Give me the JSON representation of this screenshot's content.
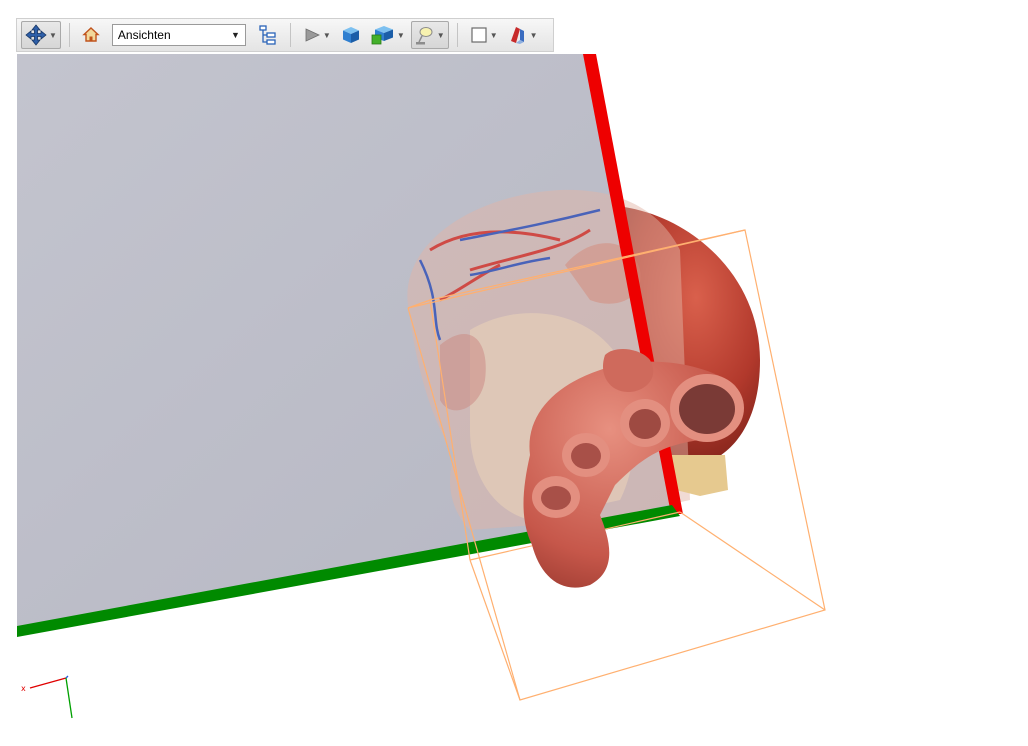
{
  "toolbar": {
    "views_select": {
      "value": "Ansichten"
    },
    "icons": [
      "move-icon",
      "home-icon",
      "model-tree-icon",
      "play-icon",
      "solid-box-icon",
      "render-mode-icon",
      "lighting-icon",
      "background-color-icon",
      "cross-section-icon"
    ]
  },
  "viewport": {
    "plane_color": "#bcbdc8",
    "red_axis_color": "#ee0000",
    "green_axis_color": "#008a00",
    "bounding_box_color": "#ffb070",
    "heart_color": "#c85a4c",
    "vessel_color": "#d4796b"
  },
  "axis_triad": {
    "x_label": "x",
    "x_color": "#e00000",
    "y_color": "#00a000"
  }
}
